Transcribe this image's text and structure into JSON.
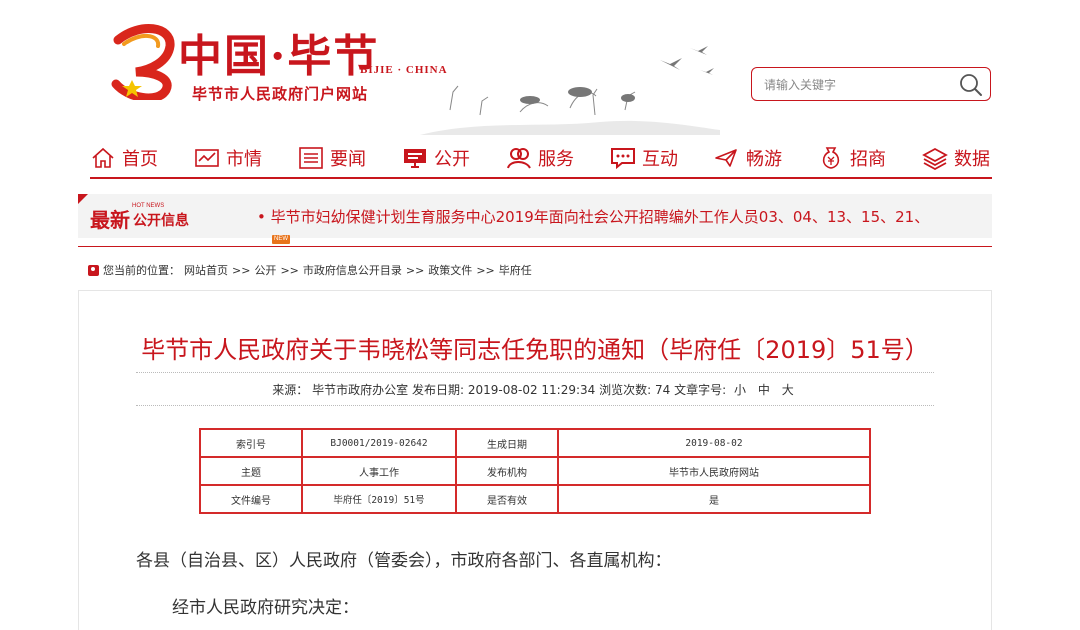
{
  "header": {
    "logo_title": "中国·毕节",
    "logo_en": "BIJIE · CHINA",
    "logo_subtitle": "毕节市人民政府门户网站"
  },
  "search": {
    "placeholder": "请输入关键字",
    "icon": "search-icon"
  },
  "nav": {
    "items": [
      {
        "label": "首页",
        "icon": "home-icon"
      },
      {
        "label": "市情",
        "icon": "chart-icon"
      },
      {
        "label": "要闻",
        "icon": "list-icon"
      },
      {
        "label": "公开",
        "icon": "monitor-icon"
      },
      {
        "label": "服务",
        "icon": "people-icon"
      },
      {
        "label": "互动",
        "icon": "chat-icon"
      },
      {
        "label": "畅游",
        "icon": "plane-icon"
      },
      {
        "label": "招商",
        "icon": "moneybag-icon"
      },
      {
        "label": "数据",
        "icon": "layers-icon"
      }
    ]
  },
  "ticker": {
    "label_big": "最新",
    "label_hot": "HOT NEWS",
    "label_small": "公开信息",
    "text": "• 毕节市妇幼保健计划生育服务中心2019年面向社会公开招聘编外工作人员03、04、13、15、21、",
    "badge": "NEW"
  },
  "breadcrumb": {
    "prefix": "您当前的位置：",
    "items": [
      "网站首页",
      "公开",
      "市政府信息公开目录",
      "政策文件",
      "毕府任"
    ],
    "sep1": " >> ",
    "sep": ">>"
  },
  "article": {
    "title": "毕节市人民政府关于韦晓松等同志任免职的通知（毕府任〔2019〕51号）",
    "meta": {
      "source_label": "来源：",
      "source": "毕节市政府办公室",
      "date_label": "发布日期:",
      "date": "2019-08-02 11:29:34",
      "views_label": "浏览次数:",
      "views": "74",
      "fontsize_label": "文章字号:",
      "sizes": [
        "小",
        "中",
        "大"
      ]
    },
    "info_table": [
      [
        "索引号",
        "BJ0001/2019-02642",
        "生成日期",
        "2019-08-02"
      ],
      [
        "主题",
        "人事工作",
        "发布机构",
        "毕节市人民政府网站"
      ],
      [
        "文件编号",
        "毕府任〔2019〕51号",
        "是否有效",
        "是"
      ]
    ],
    "para1": "各县（自治县、区）人民政府（管委会），市政府各部门、各直属机构：",
    "para2": "经市人民政府研究决定："
  },
  "colors": {
    "brand_red": "#c8161d",
    "ticker_bg": "#f3f3f3",
    "badge_orange": "#e8731a"
  }
}
